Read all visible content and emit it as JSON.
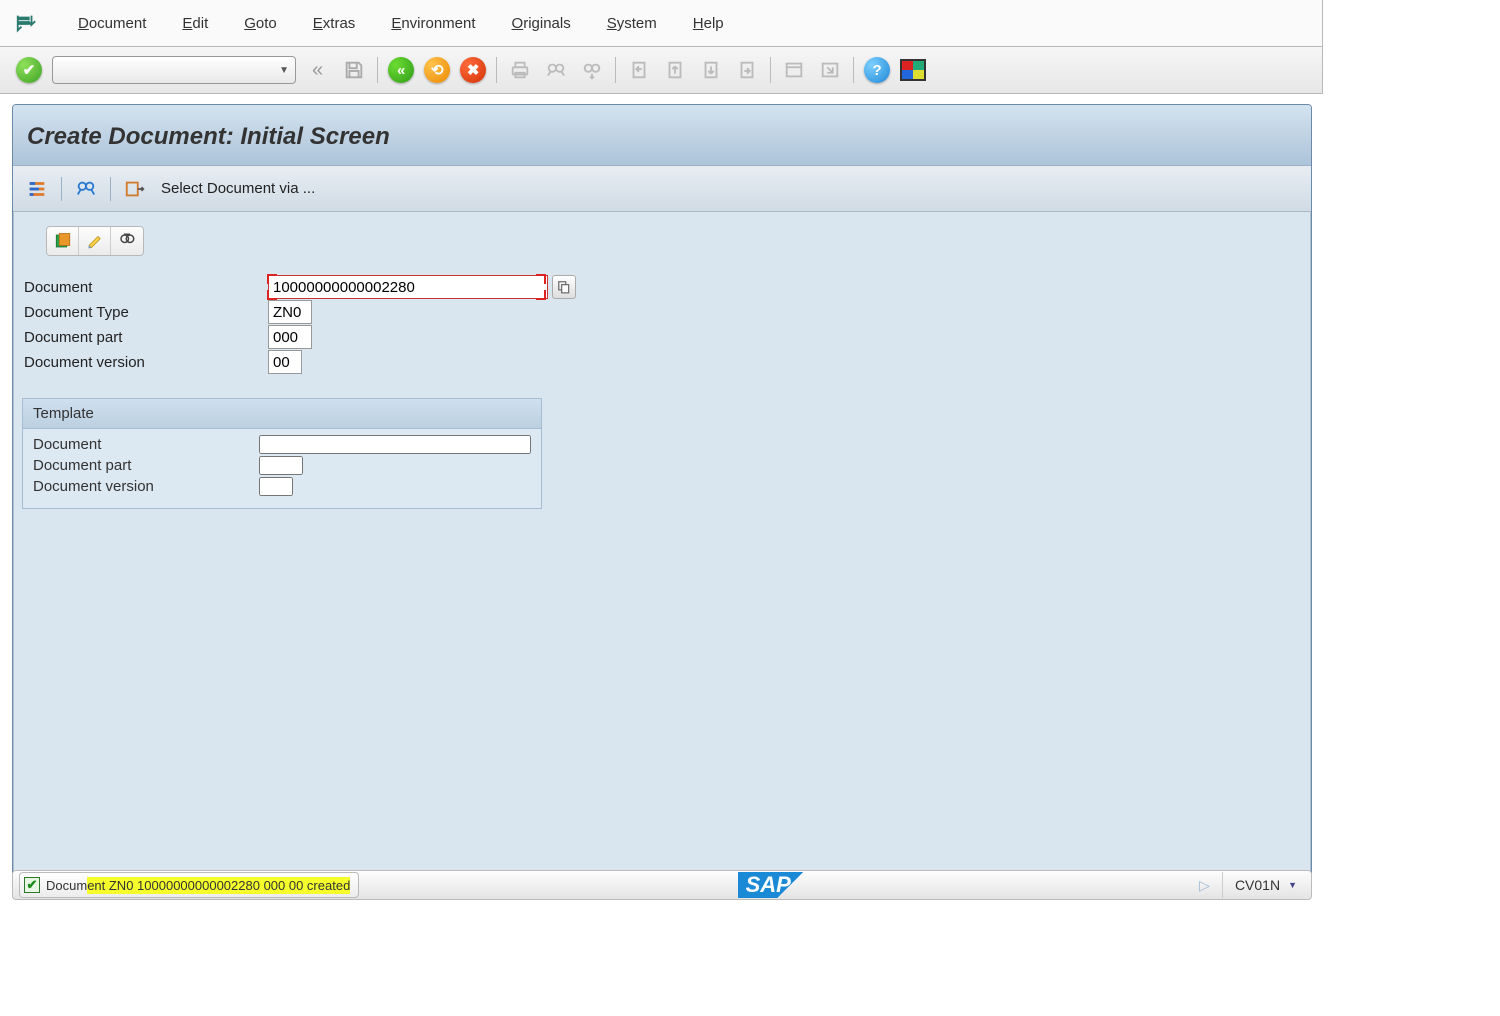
{
  "menu": {
    "items": [
      "Document",
      "Edit",
      "Goto",
      "Extras",
      "Environment",
      "Originals",
      "System",
      "Help"
    ]
  },
  "title": "Create Document: Initial Screen",
  "app_toolbar": {
    "select_label": "Select Document via ..."
  },
  "form": {
    "document_label": "Document",
    "document_value": "10000000000002280",
    "document_type_label": "Document Type",
    "document_type_value": "ZN0",
    "document_part_label": "Document part",
    "document_part_value": "000",
    "document_version_label": "Document version",
    "document_version_value": "00"
  },
  "template": {
    "header": "Template",
    "document_label": "Document",
    "document_value": "",
    "document_part_label": "Document part",
    "document_part_value": "",
    "document_version_label": "Document version",
    "document_version_value": ""
  },
  "status": {
    "message_prefix": "Docum",
    "message_highlight": "ent ZN0 10000000000002280 000 00 created",
    "tcode": "CV01N",
    "logo": "SAP"
  }
}
